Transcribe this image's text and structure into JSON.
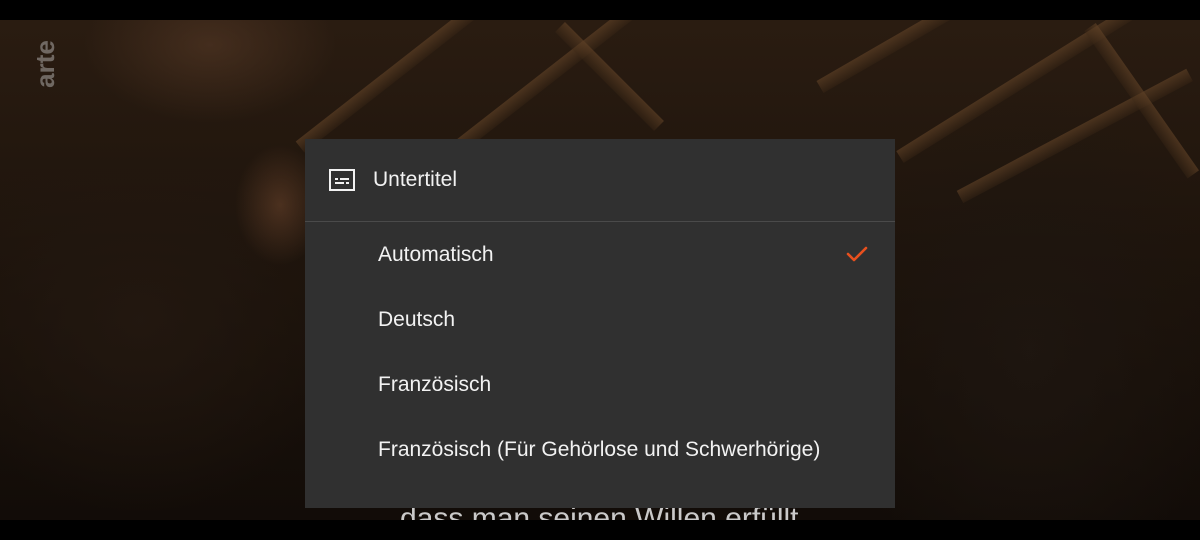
{
  "channel": {
    "logo_text": "arte",
    "logo_icon": "arte-logo"
  },
  "subtitle_caption": "dass man seinen Willen erfüllt.",
  "subtitle_menu": {
    "icon": "closed-captions-icon",
    "title": "Untertitel",
    "options": [
      {
        "label": "Automatisch",
        "selected": true
      },
      {
        "label": "Deutsch",
        "selected": false
      },
      {
        "label": "Französisch",
        "selected": false
      },
      {
        "label": "Französisch (Für Gehörlose und Schwerhörige)",
        "selected": false
      }
    ],
    "selected_icon": "checkmark-icon"
  },
  "colors": {
    "menu_background": "#303030",
    "accent": "#e8501e",
    "text": "#f2f2f2"
  }
}
